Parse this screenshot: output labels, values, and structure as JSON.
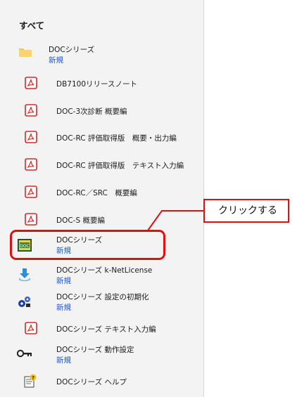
{
  "section_title": "すべて",
  "items": [
    {
      "label": "DOCシリーズ",
      "sub": "新規",
      "icon": "folder-icon"
    },
    {
      "label": "DB7100リリースノート",
      "sub": "",
      "icon": "pdf-icon"
    },
    {
      "label": "DOC-3次診断 概要編",
      "sub": "",
      "icon": "pdf-icon"
    },
    {
      "label": "DOC-RC 評価取得版　概要・出力編",
      "sub": "",
      "icon": "pdf-icon"
    },
    {
      "label": "DOC-RC 評価取得版　テキスト入力編",
      "sub": "",
      "icon": "pdf-icon"
    },
    {
      "label": "DOC-RC／SRC　概要編",
      "sub": "",
      "icon": "pdf-icon"
    },
    {
      "label": "DOC-S 概要編",
      "sub": "",
      "icon": "pdf-icon"
    },
    {
      "label": "DOCシリーズ",
      "sub": "新規",
      "icon": "doc-app-icon"
    },
    {
      "label": "DOCシリーズ k-NetLicense",
      "sub": "新規",
      "icon": "download-arrow-icon"
    },
    {
      "label": "DOCシリーズ 設定の初期化",
      "sub": "新規",
      "icon": "puzzle-gear-icon"
    },
    {
      "label": "DOCシリーズ テキスト入力編",
      "sub": "",
      "icon": "pdf-icon"
    },
    {
      "label": "DOCシリーズ 動作設定",
      "sub": "新規",
      "icon": "key-icon"
    },
    {
      "label": "DOCシリーズ ヘルプ",
      "sub": "",
      "icon": "help-file-icon"
    }
  ],
  "callout": {
    "text": "クリックする"
  },
  "colors": {
    "accent_red": "#e01010",
    "link_blue": "#1a56c8",
    "panel_bg": "#f3f3f3"
  }
}
